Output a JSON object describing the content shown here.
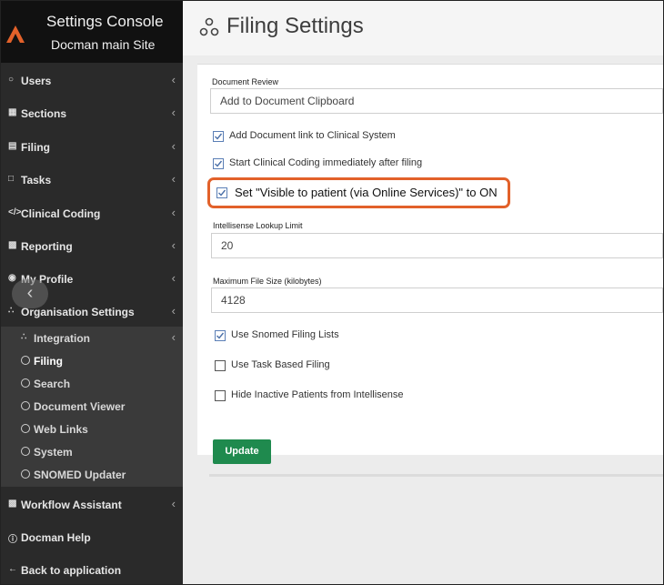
{
  "brand": {
    "title": "Settings Console",
    "subtitle": "Docman main Site",
    "accent": "#e2612a"
  },
  "sidebar": {
    "items": [
      {
        "label": "Users",
        "icon": "user-icon"
      },
      {
        "label": "Sections",
        "icon": "grid-icon"
      },
      {
        "label": "Filing",
        "icon": "filing-icon"
      },
      {
        "label": "Tasks",
        "icon": "tag-icon"
      },
      {
        "label": "Clinical Coding",
        "icon": "code-icon"
      },
      {
        "label": "Reporting",
        "icon": "chart-icon"
      },
      {
        "label": "My Profile",
        "icon": "profile-icon"
      },
      {
        "label": "Organisation Settings",
        "icon": "org-icon"
      }
    ],
    "submenu": [
      {
        "label": "Integration"
      },
      {
        "label": "Filing"
      },
      {
        "label": "Search"
      },
      {
        "label": "Document Viewer"
      },
      {
        "label": "Web Links"
      },
      {
        "label": "System"
      },
      {
        "label": "SNOMED Updater"
      }
    ],
    "bottom": [
      {
        "label": "Workflow Assistant"
      },
      {
        "label": "Docman Help"
      },
      {
        "label": "Back to application"
      }
    ]
  },
  "page": {
    "title": "Filing Settings"
  },
  "form": {
    "document_review_label": "Document Review",
    "document_review_value": "Add to Document Clipboard",
    "checks_top": [
      {
        "label": "Add Document link to Clinical System",
        "checked": true
      },
      {
        "label": "Start Clinical Coding immediately after filing",
        "checked": true
      }
    ],
    "highlighted": {
      "label": "Set \"Visible to patient (via Online Services)\" to ON",
      "checked": true
    },
    "intellisense_label": "Intellisense Lookup Limit",
    "intellisense_value": "20",
    "max_file_label": "Maximum File Size (kilobytes)",
    "max_file_value": "4128",
    "checks_bottom": [
      {
        "label": "Use Snomed Filing Lists",
        "checked": true
      },
      {
        "label": "Use Task Based Filing",
        "checked": false
      },
      {
        "label": "Hide Inactive Patients from Intellisense",
        "checked": false
      }
    ],
    "update_label": "Update"
  }
}
